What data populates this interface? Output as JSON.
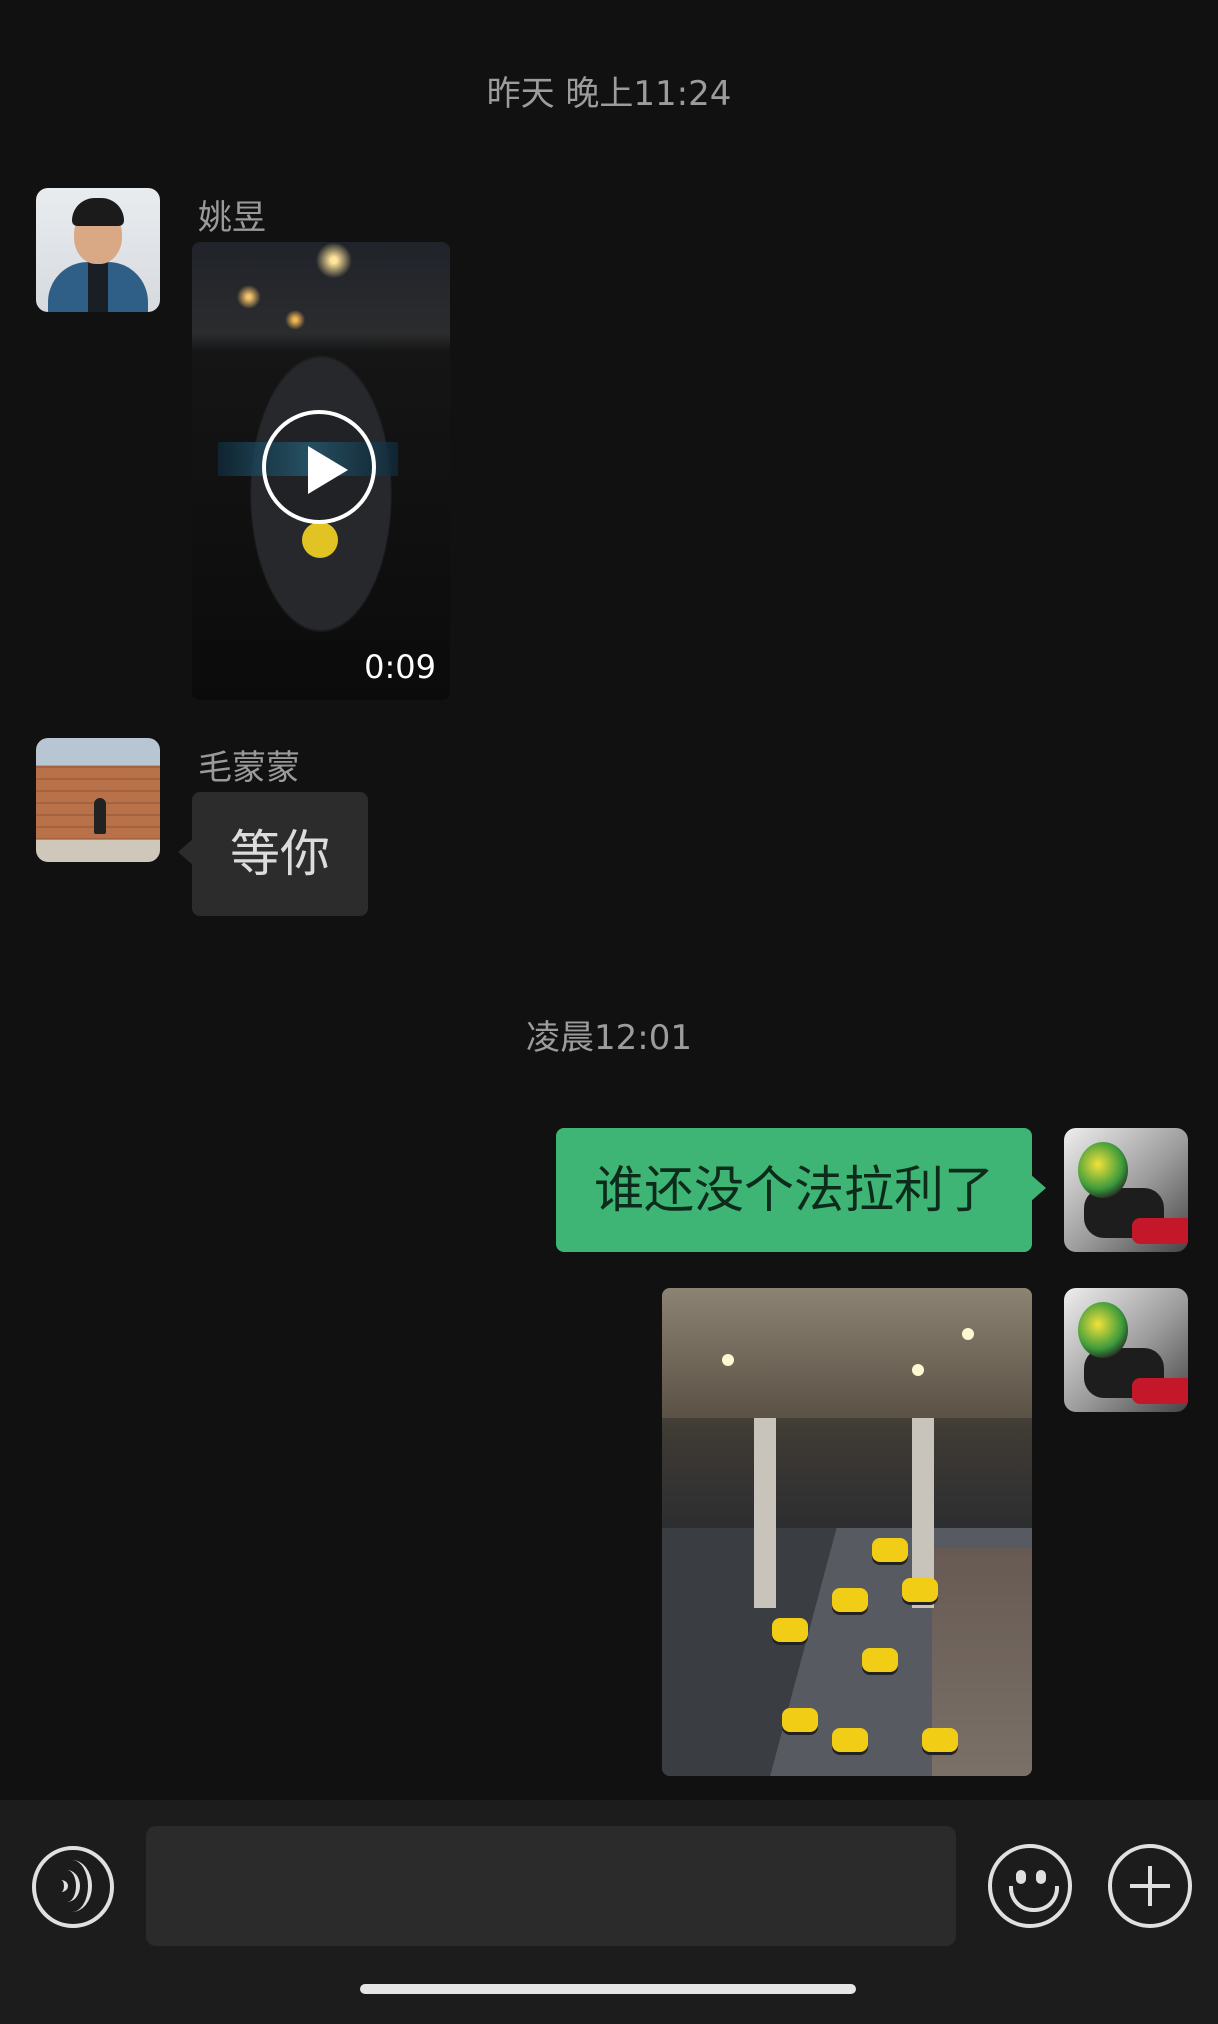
{
  "chat": {
    "timestamp_1": "昨天 晚上11:24",
    "timestamp_2": "凌晨12:01",
    "messages": [
      {
        "sender": "姚昱",
        "type": "video",
        "duration": "0:09",
        "avatar_icon": "man-portrait-avatar"
      },
      {
        "sender": "毛蒙蒙",
        "type": "text",
        "text": "等你",
        "avatar_icon": "brick-wall-photo-avatar"
      },
      {
        "sender": "me",
        "type": "text",
        "text": "谁还没个法拉利了",
        "avatar_icon": "helmet-rider-avatar"
      },
      {
        "sender": "me",
        "type": "image",
        "image_icon": "airport-taxi-queue-photo"
      }
    ]
  },
  "input_bar": {
    "voice_icon": "voice-input-icon",
    "text_value": "",
    "emoji_icon": "emoji-icon",
    "plus_icon": "plus-icon"
  },
  "colors": {
    "background": "#111111",
    "incoming_bubble": "#2c2c2c",
    "outgoing_bubble": "#3eb575",
    "timestamp_text": "#9c9c9c",
    "input_bar": "#1c1c1c"
  }
}
